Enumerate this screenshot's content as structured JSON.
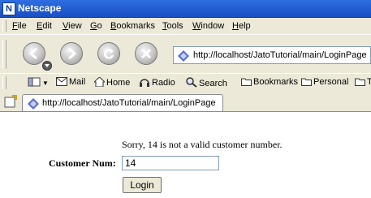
{
  "window": {
    "title": "Netscape"
  },
  "menu": {
    "items": [
      {
        "label": "File",
        "key": "F",
        "rest": "ile"
      },
      {
        "label": "Edit",
        "key": "E",
        "rest": "dit"
      },
      {
        "label": "View",
        "key": "V",
        "rest": "iew"
      },
      {
        "label": "Go",
        "key": "G",
        "rest": "o"
      },
      {
        "label": "Bookmarks",
        "key": "B",
        "rest": "ookmarks"
      },
      {
        "label": "Tools",
        "key": "T",
        "rest": "ools"
      },
      {
        "label": "Window",
        "key": "W",
        "rest": "indow"
      },
      {
        "label": "Help",
        "key": "H",
        "rest": "elp"
      }
    ]
  },
  "navigation": {
    "url": "http://localhost/JatoTutorial/main/LoginPage",
    "buttons": [
      "back-icon",
      "forward-icon",
      "reload-icon",
      "stop-icon"
    ]
  },
  "personal_toolbar": {
    "items": [
      {
        "label": "Mail",
        "icon": "mail-icon"
      },
      {
        "label": "Home",
        "icon": "home-icon"
      },
      {
        "label": "Radio",
        "icon": "radio-icon"
      },
      {
        "label": "Search",
        "icon": "search-icon"
      },
      {
        "label": "Bookmarks",
        "icon": "folder-icon"
      },
      {
        "label": "Personal",
        "icon": "folder-icon"
      },
      {
        "label": "T",
        "icon": "folder-icon"
      }
    ]
  },
  "tab": {
    "label": "http://localhost/JatoTutorial/main/LoginPage"
  },
  "page": {
    "message": "Sorry, 14 is not a valid customer number.",
    "customer_label": "Customer Num:",
    "customer_value": "14",
    "login_label": "Login"
  }
}
